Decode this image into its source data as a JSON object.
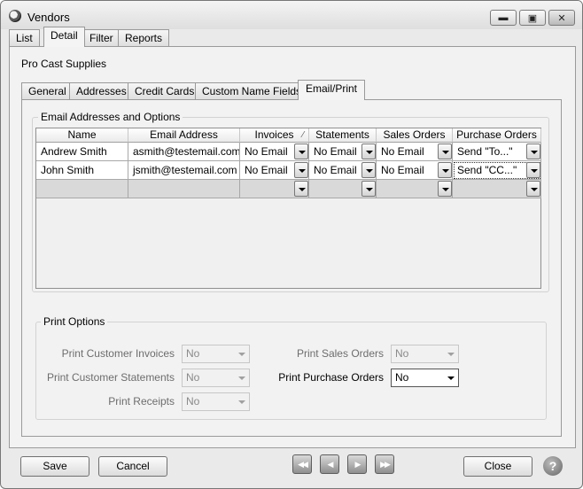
{
  "window": {
    "title": "Vendors",
    "min_glyph": "▬",
    "max_glyph": "▣",
    "close_glyph": "✕"
  },
  "main_tabs": [
    "List",
    "Detail",
    "Filter",
    "Reports"
  ],
  "vendor_name": "Pro Cast Supplies",
  "detail_tabs": [
    "General",
    "Addresses",
    "Credit Cards",
    "Custom Name Fields",
    "Email/Print"
  ],
  "email_group": {
    "title": "Email Addresses and Options",
    "columns": [
      "Name",
      "Email Address",
      "Invoices",
      "Statements",
      "Sales Orders",
      "Purchase Orders"
    ],
    "sort_glyph": "⁄",
    "rows": [
      [
        "Andrew Smith",
        "asmith@testemail.com",
        "No Email",
        "No Email",
        "No Email",
        "Send \"To...\""
      ],
      [
        "John Smith",
        "jsmith@testemail.com",
        "No Email",
        "No Email",
        "No Email",
        "Send \"CC...\""
      ]
    ]
  },
  "print_group": {
    "title": "Print Options",
    "print_customer_invoices": {
      "label": "Print Customer Invoices",
      "value": "No"
    },
    "print_customer_statements": {
      "label": "Print Customer Statements",
      "value": "No"
    },
    "print_receipts": {
      "label": "Print Receipts",
      "value": "No"
    },
    "print_sales_orders": {
      "label": "Print Sales Orders",
      "value": "No"
    },
    "print_purchase_orders": {
      "label": "Print Purchase Orders",
      "value": "No"
    }
  },
  "buttons": {
    "save": "Save",
    "cancel": "Cancel",
    "close": "Close",
    "help": "?"
  },
  "nav": {
    "first": "◀◀",
    "prev": "◀",
    "next": "▶",
    "last": "▶▶"
  }
}
